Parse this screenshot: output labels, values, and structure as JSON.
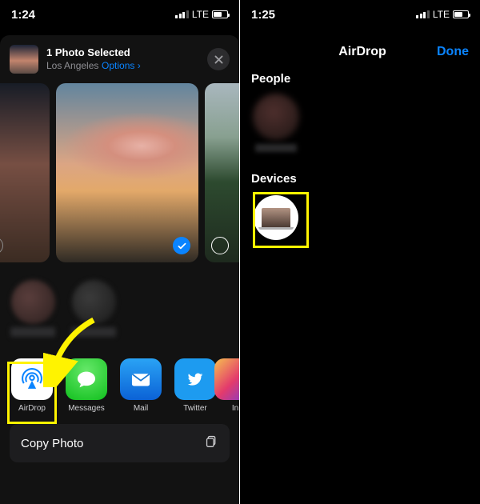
{
  "left": {
    "status": {
      "time": "1:24",
      "netLabel": "LTE"
    },
    "header": {
      "title": "1 Photo Selected",
      "subtitle": "Los Angeles",
      "optionsLabel": "Options",
      "chevron": "›"
    },
    "apps": [
      {
        "key": "airdrop",
        "label": "AirDrop"
      },
      {
        "key": "messages",
        "label": "Messages"
      },
      {
        "key": "mail",
        "label": "Mail"
      },
      {
        "key": "twitter",
        "label": "Twitter"
      },
      {
        "key": "instagram",
        "label": "In"
      }
    ],
    "actions": {
      "copy": "Copy Photo"
    }
  },
  "right": {
    "status": {
      "time": "1:25",
      "netLabel": "LTE"
    },
    "title": "AirDrop",
    "doneLabel": "Done",
    "sections": {
      "people": "People",
      "devices": "Devices"
    }
  }
}
